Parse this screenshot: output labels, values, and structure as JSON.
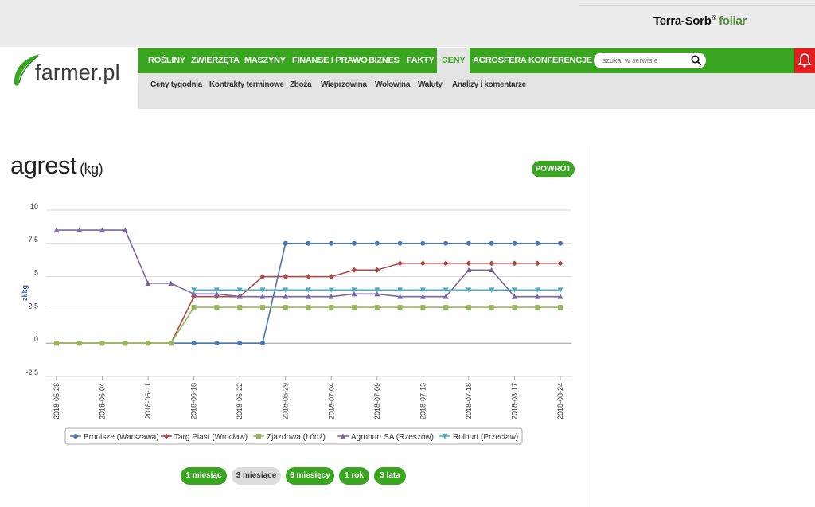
{
  "promo": {
    "brand": "Terra-Sorb",
    "reg": "®",
    "product": "foliar"
  },
  "logo": {
    "text": "farmer.pl"
  },
  "nav": {
    "items": [
      {
        "label": "ROŚLINY",
        "name": "nav-item-rosliny"
      },
      {
        "label": "ZWIERZĘTA",
        "name": "nav-item-zwierzeta"
      },
      {
        "label": "MASZYNY",
        "name": "nav-item-maszyny"
      },
      {
        "label": "FINANSE I PRAWO",
        "name": "nav-item-finanse"
      },
      {
        "label": "BIZNES",
        "name": "nav-item-biznes"
      },
      {
        "label": "FAKTY",
        "name": "nav-item-fakty"
      },
      {
        "label": "CENY",
        "name": "nav-item-ceny",
        "active": true
      },
      {
        "label": "AGROSFERA",
        "name": "nav-item-agrosfera"
      },
      {
        "label": "KONFERENCJE",
        "name": "nav-item-konferencje"
      }
    ],
    "search_placeholder": "szukaj w serwisie"
  },
  "subnav": {
    "items": [
      "Ceny tygodnia",
      "Kontrakty terminowe",
      "Zboża",
      "Wieprzowina",
      "Wołowina",
      "Waluty",
      "Analizy i komentarze"
    ]
  },
  "page": {
    "title": "agrest",
    "unit": "(kg)",
    "back_label": "POWRÓT"
  },
  "ranges": [
    {
      "label": "1 miesiąc",
      "selected": false
    },
    {
      "label": "3 miesiące",
      "selected": true
    },
    {
      "label": "6 miesięcy",
      "selected": false
    },
    {
      "label": "1 rok",
      "selected": false
    },
    {
      "label": "3 lata",
      "selected": false
    }
  ],
  "colors": {
    "accent": "#3aa520",
    "alert": "#e21f1f"
  },
  "chart_data": {
    "type": "line",
    "ylabel": "zł/kg",
    "ylim": [
      -2.5,
      10
    ],
    "yticks": [
      -2.5,
      0,
      2.5,
      5,
      7.5,
      10
    ],
    "ytick_labels": [
      "-2.5",
      "0",
      "2.5",
      "5",
      "7.5",
      "10"
    ],
    "x_labels": [
      "2018-05-28",
      "2018-06-04",
      "2018-06-11",
      "2018-06-18",
      "2018-06-22",
      "2018-06-29",
      "2018-07-04",
      "2018-07-09",
      "2018-07-13",
      "2018-07-18",
      "2018-08-17",
      "2018-08-24"
    ],
    "legend_position": "bottom",
    "series": [
      {
        "name": "Bronisze (Warszawa)",
        "color": "#4a77b4",
        "marker": "circle",
        "values": [
          0,
          0,
          0,
          0,
          0,
          0,
          0,
          0,
          0,
          0,
          7.5,
          7.5,
          7.5,
          7.5,
          7.5,
          7.5,
          7.5,
          7.5,
          7.5,
          7.5,
          7.5,
          7.5,
          7.5
        ]
      },
      {
        "name": "Targ Piast (Wrocław)",
        "color": "#b04a47",
        "marker": "diamond",
        "values": [
          0,
          0,
          0,
          0,
          0,
          0,
          3.5,
          3.5,
          3.5,
          5,
          5,
          5,
          5,
          5.5,
          5.5,
          6,
          6,
          6,
          6,
          6,
          6,
          6,
          6
        ]
      },
      {
        "name": "Zjazdowa (Łódź)",
        "color": "#97b857",
        "marker": "square",
        "values": [
          0,
          0,
          0,
          0,
          0,
          0,
          2.7,
          2.7,
          2.7,
          2.7,
          2.7,
          2.7,
          2.7,
          2.7,
          2.7,
          2.7,
          2.7,
          2.7,
          2.7,
          2.7,
          2.7,
          2.7,
          2.7
        ]
      },
      {
        "name": "Agrohurt SA (Rzeszów)",
        "color": "#7e66a1",
        "marker": "triangle",
        "values": [
          8.5,
          8.5,
          8.5,
          8.5,
          4.5,
          4.5,
          3.7,
          3.7,
          3.5,
          3.5,
          3.5,
          3.5,
          3.5,
          3.7,
          3.7,
          3.5,
          3.5,
          3.5,
          5.5,
          5.5,
          3.5,
          3.5,
          3.5
        ]
      },
      {
        "name": "Rolhurt (Przecław)",
        "color": "#4bacc6",
        "marker": "triangle-down",
        "values": [
          null,
          null,
          null,
          null,
          null,
          null,
          4,
          4,
          4,
          4,
          4,
          4,
          4,
          4,
          4,
          4,
          4,
          4,
          4,
          4,
          4,
          4,
          4
        ]
      }
    ]
  }
}
